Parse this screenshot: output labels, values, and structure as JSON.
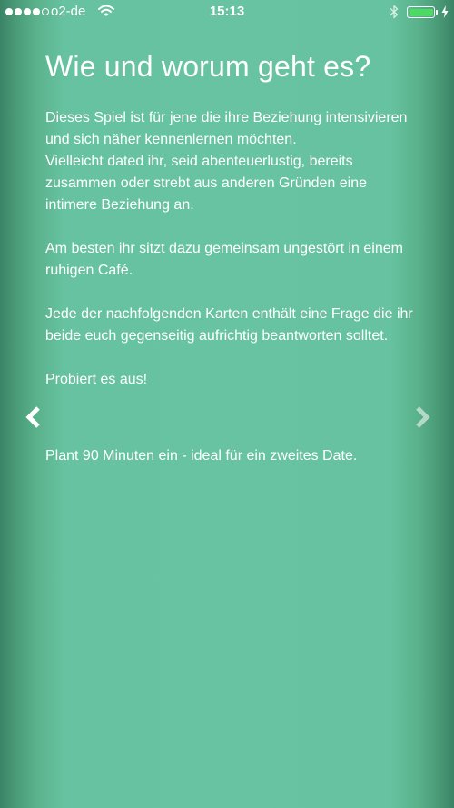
{
  "status_bar": {
    "carrier": "o2-de",
    "time": "15:13",
    "signal_dots_filled": 4,
    "signal_dots_total": 5,
    "battery_level": 1.0,
    "battery_color": "#4cd964"
  },
  "page": {
    "title": "Wie und worum geht es?",
    "paragraphs": [
      "Dieses Spiel ist für jene die ihre Beziehung intensivieren und sich näher kennenlernen möchten.\nVielleicht dated ihr, seid abenteuerlustig, bereits zusammen oder strebt aus anderen Gründen eine intimere Beziehung an.",
      "Am besten ihr sitzt dazu gemeinsam ungestört in einem ruhigen Café.",
      "Jede der nachfolgenden Karten enthält eine Frage die ihr beide euch gegenseitig aufrichtig beantworten solltet.",
      "Probiert es aus!",
      "Plant 90 Minuten ein - ideal für ein zweites Date."
    ]
  },
  "navigation": {
    "prev_icon": "chevron-left-icon",
    "next_icon": "chevron-right-icon"
  },
  "colors": {
    "background": "#67c3a1",
    "edge_shadow": "#3b8466",
    "text": "#ffffff"
  }
}
